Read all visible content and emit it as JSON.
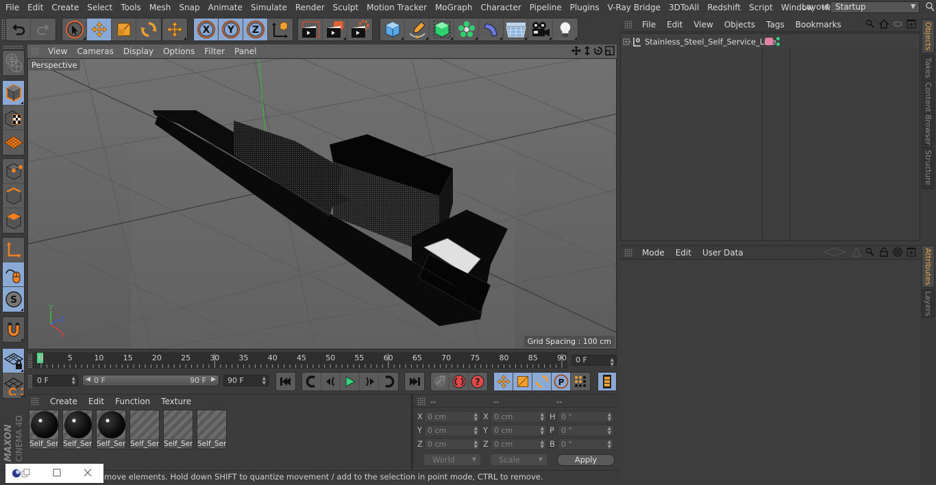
{
  "menubar": {
    "items": [
      "File",
      "Edit",
      "Create",
      "Select",
      "Tools",
      "Mesh",
      "Snap",
      "Animate",
      "Simulate",
      "Render",
      "Sculpt",
      "Motion Tracker",
      "MoGraph",
      "Character",
      "Pipeline",
      "Plugins",
      "V-Ray Bridge",
      "3DToAll",
      "Redshift",
      "Script",
      "Window",
      "Help"
    ],
    "layout_label": "Layout:",
    "layout_value": "Startup"
  },
  "toolbar": {
    "groups": [
      {
        "name": "history",
        "buttons": [
          "undo-icon",
          "redo-icon"
        ]
      },
      {
        "name": "tools",
        "buttons": [
          "live-selection-icon",
          "move-icon",
          "scale-icon",
          "rotate-icon"
        ]
      },
      {
        "name": "recent",
        "buttons": [
          "move-recent-icon"
        ]
      },
      {
        "name": "axis",
        "buttons": [
          "x-axis-lock-icon",
          "y-axis-lock-icon",
          "z-axis-lock-icon",
          "coordinate-system-icon"
        ]
      },
      {
        "name": "render",
        "buttons": [
          "render-view-icon",
          "render-to-picture-viewer-icon",
          "render-settings-icon"
        ]
      },
      {
        "name": "objects",
        "buttons": [
          "cube-icon",
          "pen-spline-icon",
          "subdivision-icon",
          "mograph-cloner-icon",
          "deformer-bend-icon",
          "floor-icon",
          "camera-icon",
          "light-icon"
        ]
      }
    ]
  },
  "leftbar": {
    "buttons": [
      "make-editable-icon",
      "model-mode-icon",
      "texture-mode-icon",
      "workplane-icon",
      "points-mode-icon",
      "edges-mode-icon",
      "polygons-mode-icon",
      "axis-mode-icon",
      "tweak-mode-icon",
      "solo-icon",
      "snap-magnet-icon",
      "lock-workplane-icon",
      "workplane-align-icon"
    ],
    "brand": "MAXON CINEMA 4D"
  },
  "viewport": {
    "menu": [
      "View",
      "Cameras",
      "Display",
      "Options",
      "Filter",
      "Panel"
    ],
    "label": "Perspective",
    "grid_spacing": "Grid Spacing : 100 cm",
    "nav_icons": [
      "pan-icon",
      "dolly-icon",
      "orbit-icon",
      "maximize-view-icon"
    ],
    "axis_labels": {
      "x": "X",
      "y": "Y",
      "z": "Z"
    }
  },
  "timeline": {
    "ticks": [
      "0",
      "5",
      "10",
      "15",
      "20",
      "25",
      "30",
      "35",
      "40",
      "45",
      "50",
      "55",
      "60",
      "65",
      "70",
      "75",
      "80",
      "85",
      "90"
    ],
    "current_frame": "0 F",
    "start_frame": "0 F",
    "range_start": "0 F",
    "range_end": "90 F",
    "end_frame": "90 F",
    "playhead_frame": 0,
    "max_frame": 90
  },
  "playback": {
    "buttons": [
      "go-to-start-icon",
      "previous-key-icon",
      "previous-frame-icon",
      "play-icon",
      "next-frame-icon",
      "next-key-icon",
      "go-to-end-icon",
      "record-key-icon",
      "autokey-icon",
      "keyframe-selection-icon",
      "move-key-icon",
      "scale-key-icon",
      "rotate-key-icon",
      "param-key-icon",
      "pla-key-icon",
      "timeline-icon"
    ]
  },
  "materials": {
    "menu": [
      "Create",
      "Edit",
      "Function",
      "Texture"
    ],
    "items": [
      {
        "label": "Self_Ser",
        "has_preview": true
      },
      {
        "label": "Self_Ser",
        "has_preview": true
      },
      {
        "label": "Self_Ser",
        "has_preview": true
      },
      {
        "label": "Self_Ser",
        "has_preview": false
      },
      {
        "label": "Self_Ser",
        "has_preview": false
      },
      {
        "label": "Self_Ser",
        "has_preview": false
      }
    ]
  },
  "coordinates": {
    "headers": [
      "--",
      "--",
      "--"
    ],
    "rows": [
      {
        "pos_label": "X",
        "pos": "0 cm",
        "size_label": "X",
        "size": "0 cm",
        "rot_label": "H",
        "rot": "0 °"
      },
      {
        "pos_label": "Y",
        "pos": "0 cm",
        "size_label": "Y",
        "size": "0 cm",
        "rot_label": "P",
        "rot": "0 °"
      },
      {
        "pos_label": "Z",
        "pos": "0 cm",
        "size_label": "Z",
        "size": "0 cm",
        "rot_label": "B",
        "rot": "0 °"
      }
    ],
    "space": "World",
    "mode": "Scale",
    "apply_label": "Apply"
  },
  "status": {
    "text": "move elements. Hold down SHIFT to quantize movement / add to the selection in point mode, CTRL to remove."
  },
  "objects_panel": {
    "menu": [
      "File",
      "Edit",
      "View",
      "Objects",
      "Tags",
      "Bookmarks"
    ],
    "objects": [
      {
        "name": "Stainless_Steel_Self_Service_Line",
        "layer_color": "#e87fa8",
        "visibility": "green"
      }
    ]
  },
  "attributes_panel": {
    "menu": [
      "Mode",
      "Edit",
      "User Data"
    ]
  },
  "right_tabs": {
    "top": [
      {
        "label": "Objects",
        "active": true
      },
      {
        "label": "Takes",
        "active": false
      },
      {
        "label": "Content Browser",
        "active": false
      },
      {
        "label": "Structure",
        "active": false
      }
    ],
    "bottom": [
      {
        "label": "Attributes",
        "active": true
      },
      {
        "label": "Layers",
        "active": false
      }
    ]
  },
  "colors": {
    "accent_blue": "#8aa9d4",
    "accent_orange": "#e8a544",
    "playhead_green": "#4fd68a"
  }
}
